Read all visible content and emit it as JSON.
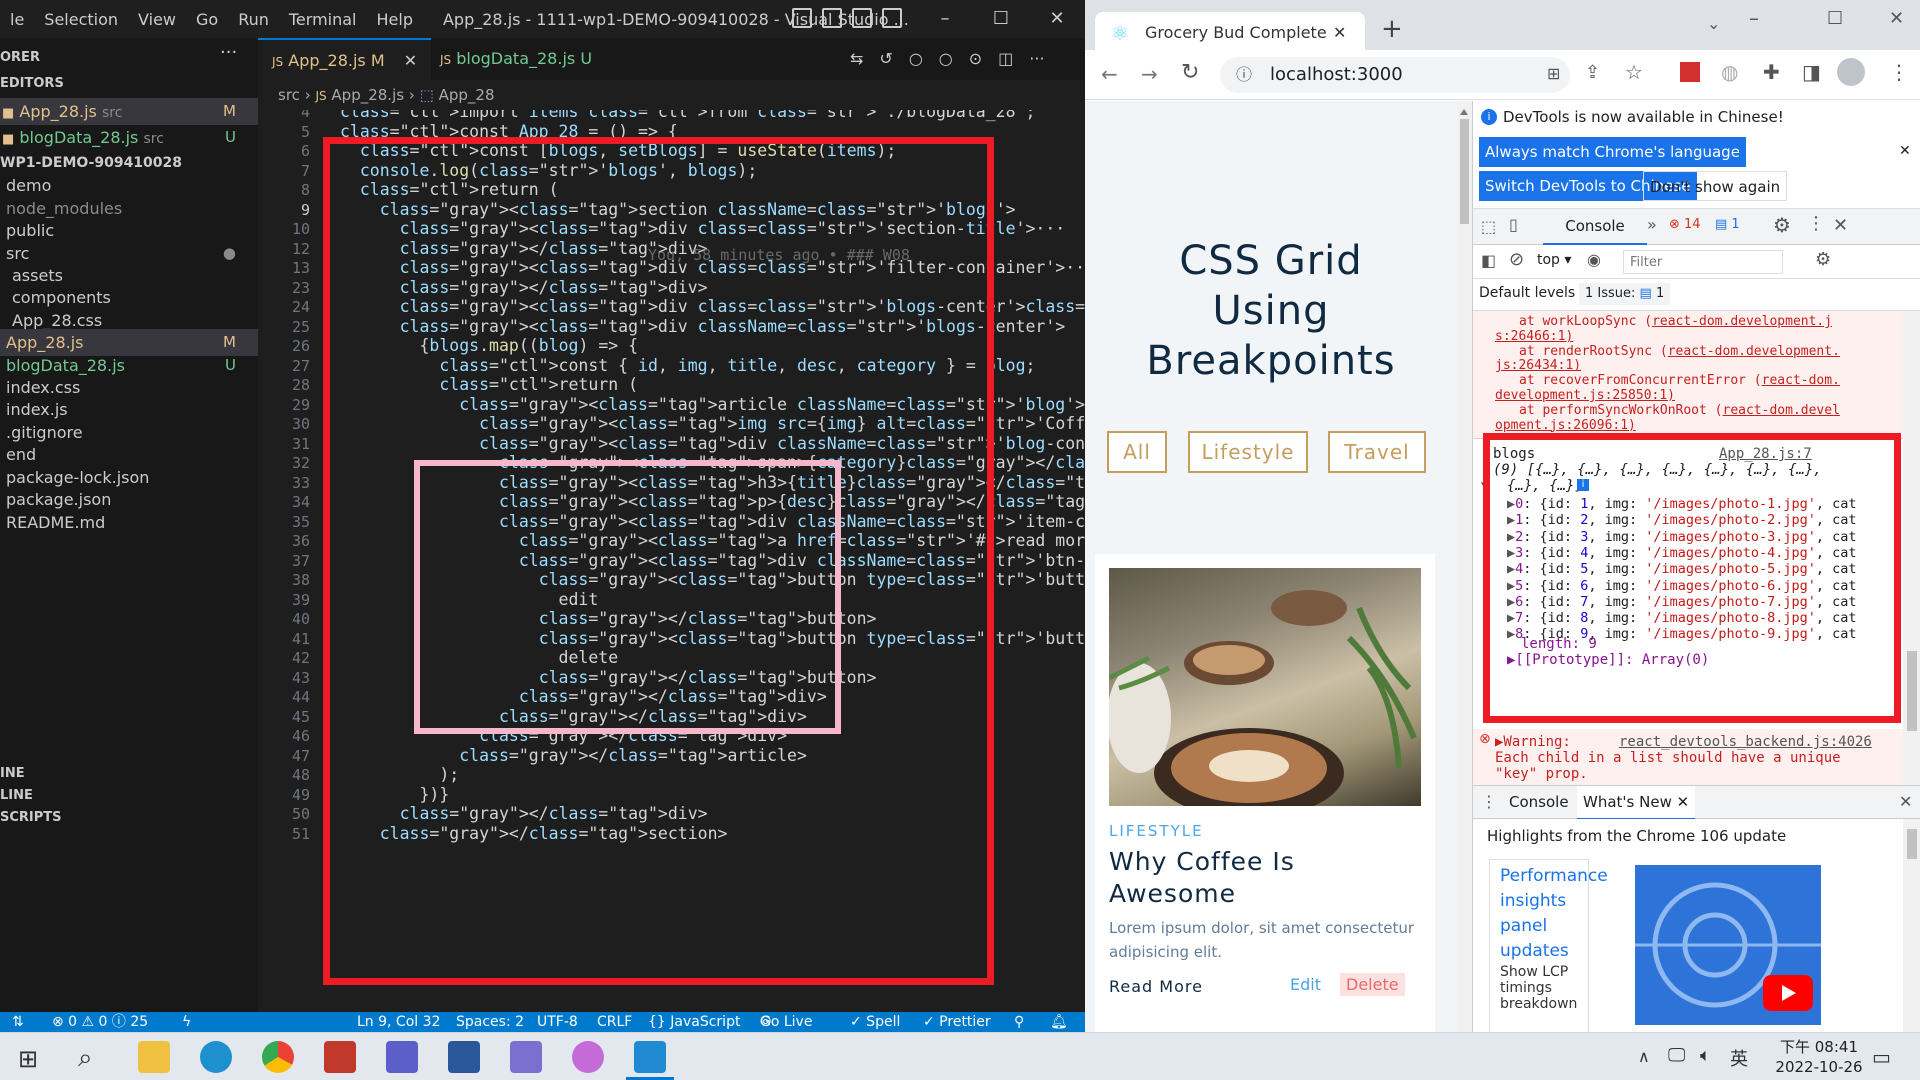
{
  "vscode": {
    "menu": [
      "le",
      "Selection",
      "View",
      "Go",
      "Run",
      "Terminal",
      "Help"
    ],
    "window_title": "App_28.js - 1111-wp1-DEMO-909410028 - Visual Studio ...",
    "explorer": {
      "header": "ORER",
      "section": "EDITORS",
      "open_editors": [
        {
          "name": "App_28.js",
          "hint": "src",
          "badge": "M"
        },
        {
          "name": "blogData_28.js",
          "hint": "src",
          "badge": "U"
        }
      ],
      "root": "WP1-DEMO-909410028",
      "items": [
        {
          "name": "demo",
          "badge": ""
        },
        {
          "name": "node_modules",
          "badge": ""
        },
        {
          "name": "public",
          "badge": ""
        },
        {
          "name": "src",
          "badge": "●"
        },
        {
          "name": "assets",
          "badge": ""
        },
        {
          "name": "components",
          "badge": ""
        },
        {
          "name": "App_28.css",
          "badge": ""
        },
        {
          "name": "App_28.js",
          "badge": "M"
        },
        {
          "name": "blogData_28.js",
          "badge": "U"
        },
        {
          "name": "index.css",
          "badge": ""
        },
        {
          "name": "index.js",
          "badge": ""
        },
        {
          "name": ".gitignore",
          "badge": ""
        },
        {
          "name": "end",
          "badge": ""
        },
        {
          "name": "package-lock.json",
          "badge": ""
        },
        {
          "name": "package.json",
          "badge": ""
        },
        {
          "name": "README.md",
          "badge": ""
        }
      ],
      "bottom_sections": [
        "INE",
        "LINE",
        "SCRIPTS"
      ]
    },
    "tabs": [
      {
        "label": "App_28.js",
        "badge": "M"
      },
      {
        "label": "blogData_28.js",
        "badge": "U"
      }
    ],
    "breadcrumb": {
      "folder": "src",
      "file": "App_28.js",
      "symbol": "App_28"
    },
    "code_lines": [
      {
        "n": "4",
        "text": "import items from './blogData_28';"
      },
      {
        "n": "5",
        "text": "const App_28 = () => {"
      },
      {
        "n": "6",
        "text": "  const [blogs, setBlogs] = useState(items);"
      },
      {
        "n": "7",
        "text": "  console.log('blogs', blogs);"
      },
      {
        "n": "8",
        "text": "  return ("
      },
      {
        "n": "9",
        "text": "    <section className='blogs'>"
      },
      {
        "n": "10",
        "text": "      <div class='section-title'>···"
      },
      {
        "n": "12",
        "text": "      </div>"
      },
      {
        "n": "13",
        "text": "      <div class='filter-container'>···"
      },
      {
        "n": "23",
        "text": "      </div>"
      },
      {
        "n": "24",
        "text": "      <div class='blogs-center'></div>"
      },
      {
        "n": "25",
        "text": "      <div className='blogs-center'>"
      },
      {
        "n": "26",
        "text": "        {blogs.map((blog) => {"
      },
      {
        "n": "27",
        "text": "          const { id, img, title, desc, category } = blog;"
      },
      {
        "n": "28",
        "text": "          return ("
      },
      {
        "n": "29",
        "text": "            <article className='blog'>"
      },
      {
        "n": "30",
        "text": "              <img src={img} alt='Coffee photo' className='img blog"
      },
      {
        "n": "31",
        "text": "              <div className='blog-content'>"
      },
      {
        "n": "32",
        "text": "                <span>{category}</span>"
      },
      {
        "n": "33",
        "text": "                <h3>{title}</h3>"
      },
      {
        "n": "34",
        "text": "                <p>{desc}</p>"
      },
      {
        "n": "35",
        "text": "                <div className='item-control'>"
      },
      {
        "n": "36",
        "text": "                  <a href='#'>read more</a>"
      },
      {
        "n": "37",
        "text": "                  <div className='btn-container'>"
      },
      {
        "n": "38",
        "text": "                    <button type='button' className='edit-btn'>"
      },
      {
        "n": "39",
        "text": "                      edit"
      },
      {
        "n": "40",
        "text": "                    </button>"
      },
      {
        "n": "41",
        "text": "                    <button type='button' className='delete-btn'>"
      },
      {
        "n": "42",
        "text": "                      delete"
      },
      {
        "n": "43",
        "text": "                    </button>"
      },
      {
        "n": "44",
        "text": "                  </div>"
      },
      {
        "n": "45",
        "text": "                </div>"
      },
      {
        "n": "46",
        "text": "              </div>"
      },
      {
        "n": "47",
        "text": "            </article>"
      },
      {
        "n": "48",
        "text": "          );"
      },
      {
        "n": "49",
        "text": "        })}"
      },
      {
        "n": "50",
        "text": "      </div>"
      },
      {
        "n": "51",
        "text": "    </section>"
      }
    ],
    "blame": "You, 58 minutes ago • ### W08",
    "status": {
      "problems": "⊗ 0 ⚠ 0 ⓘ 25",
      "position": "Ln 9, Col 32",
      "spaces": "Spaces: 2",
      "encoding": "UTF-8",
      "eol": "CRLF",
      "language": "{} JavaScript",
      "golive": "Go Live",
      "spell": "✓ Spell",
      "prettier": "✓ Prettier"
    }
  },
  "chrome": {
    "tab_title": "Grocery Bud Complete",
    "url": "localhost:3000",
    "page": {
      "title_lines": [
        "CSS Grid",
        "Using",
        "Breakpoints"
      ],
      "filters": [
        "All",
        "Lifestyle",
        "Travel"
      ],
      "card": {
        "category": "LIFESTYLE",
        "title_lines": [
          "Why Coffee Is",
          "Awesome"
        ],
        "desc_lines": [
          "Lorem ipsum dolor, sit amet consectetur",
          "adipisicing elit."
        ],
        "read_more": "Read More",
        "edit": "Edit",
        "delete": "Delete"
      }
    },
    "devtools": {
      "banner": "DevTools is now available in Chinese!",
      "btn_match": "Always match Chrome's language",
      "btn_switch": "Switch DevTools to Chinese",
      "btn_dont": "Don't show again",
      "tab_console": "Console",
      "errors": "14",
      "messages": "1",
      "context": "top",
      "filter_placeholder": "Filter",
      "levels": "Default levels",
      "issues": "1 Issue:",
      "issues_count": "1",
      "stack": [
        {
          "text": "at workLoopSync (",
          "link": "react-dom.development.j"
        },
        {
          "text": "",
          "link": "s:26466:1)"
        },
        {
          "text": "at renderRootSync (",
          "link": "react-dom.development."
        },
        {
          "text": "",
          "link": "js:26434:1)"
        },
        {
          "text": "at recoverFromConcurrentError (",
          "link": "react-dom."
        },
        {
          "text": "",
          "link": "development.js:25850:1)"
        },
        {
          "text": "at performSyncWorkOnRoot (",
          "link": "react-dom.devel"
        },
        {
          "text": "",
          "link": "opment.js:26096:1)"
        }
      ],
      "log_label": "blogs",
      "log_source": "App_28.js:7",
      "array_summary_1": "(9) [{…}, {…}, {…}, {…}, {…}, {…}, {…},",
      "array_summary_2": "{…}, {…}]",
      "array_items": [
        {
          "i": "0",
          "id": "1",
          "img": "'/images/photo-1.jpg'"
        },
        {
          "i": "1",
          "id": "2",
          "img": "'/images/photo-2.jpg'"
        },
        {
          "i": "2",
          "id": "3",
          "img": "'/images/photo-3.jpg'"
        },
        {
          "i": "3",
          "id": "4",
          "img": "'/images/photo-4.jpg'"
        },
        {
          "i": "4",
          "id": "5",
          "img": "'/images/photo-5.jpg'"
        },
        {
          "i": "5",
          "id": "6",
          "img": "'/images/photo-6.jpg'"
        },
        {
          "i": "6",
          "id": "7",
          "img": "'/images/photo-7.jpg'"
        },
        {
          "i": "7",
          "id": "8",
          "img": "'/images/photo-8.jpg'"
        },
        {
          "i": "8",
          "id": "9",
          "img": "'/images/photo-9.jpg'"
        }
      ],
      "length_label": "length: 9",
      "prototype": "▶[[Prototype]]: Array(0)",
      "warning_label": "▶Warning:",
      "warning_source": "react_devtools_backend.js:4026",
      "warning_line2": "Each child in a list should have a unique",
      "warning_line3": "\"key\" prop.",
      "drawer_console": "Console",
      "drawer_whatsnew": "What's New",
      "highlights": "Highlights from the Chrome 106 update",
      "perf_lines": [
        "Performance",
        "insights",
        "panel",
        "updates"
      ],
      "lcp_lines": [
        "Show LCP",
        "timings",
        "breakdown"
      ]
    }
  },
  "taskbar": {
    "time": "下午 08:41",
    "date": "2022-10-26",
    "ime": "英"
  },
  "colors": {
    "annotation_red": "#ed1c24",
    "annotation_pink": "#f7b6c9",
    "vscode_accent": "#007acc",
    "brand_gold": "#c59d5f"
  }
}
